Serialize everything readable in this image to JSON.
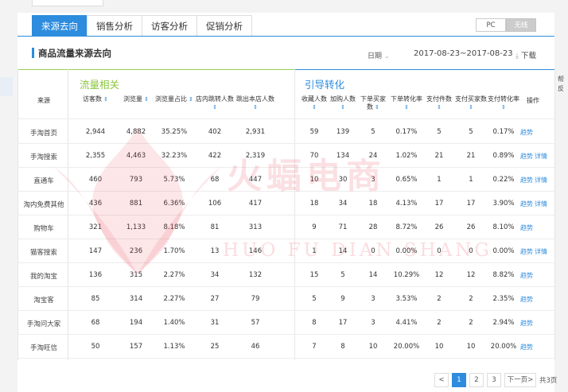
{
  "tabs": [
    {
      "label": "来源去向",
      "active": true
    },
    {
      "label": "销售分析",
      "active": false
    },
    {
      "label": "访客分析",
      "active": false
    },
    {
      "label": "促销分析",
      "active": false
    }
  ],
  "device_toggle": {
    "pc": "PC",
    "wireless": "无线",
    "selected": "无线"
  },
  "section": {
    "title": "商品流量来源去向",
    "date_label": "日期",
    "date_range": "2017-08-23~2017-08-23",
    "download": "下载"
  },
  "groups": {
    "traffic": "流量相关",
    "conversion": "引导转化"
  },
  "columns": [
    "来源",
    "访客数",
    "浏览量",
    "浏览量占比",
    "店内跳转人数",
    "跳出本店人数",
    "收藏人数",
    "加购人数",
    "下单买家数",
    "下单转化率",
    "支付件数",
    "支付买家数",
    "支付转化率",
    "操作"
  ],
  "rows": [
    {
      "src": "手淘首页",
      "v": [
        "2,944",
        "4,882",
        "35.25%",
        "402",
        "2,931",
        "59",
        "139",
        "5",
        "0.17%",
        "5",
        "5",
        "0.17%"
      ],
      "actions": [
        "趋势"
      ]
    },
    {
      "src": "手淘搜索",
      "v": [
        "2,355",
        "4,463",
        "32.23%",
        "422",
        "2,319",
        "70",
        "134",
        "24",
        "1.02%",
        "21",
        "21",
        "0.89%"
      ],
      "actions": [
        "趋势",
        "详情"
      ]
    },
    {
      "src": "直通车",
      "v": [
        "460",
        "793",
        "5.73%",
        "68",
        "447",
        "10",
        "30",
        "3",
        "0.65%",
        "1",
        "1",
        "0.22%"
      ],
      "actions": [
        "趋势",
        "详情"
      ]
    },
    {
      "src": "淘内免费其他",
      "v": [
        "436",
        "881",
        "6.36%",
        "106",
        "417",
        "18",
        "34",
        "18",
        "4.13%",
        "17",
        "17",
        "3.90%"
      ],
      "actions": [
        "趋势",
        "详情"
      ]
    },
    {
      "src": "购物车",
      "v": [
        "321",
        "1,133",
        "8.18%",
        "81",
        "313",
        "9",
        "71",
        "28",
        "8.72%",
        "26",
        "26",
        "8.10%"
      ],
      "actions": [
        "趋势"
      ]
    },
    {
      "src": "猫客搜索",
      "v": [
        "147",
        "236",
        "1.70%",
        "13",
        "146",
        "1",
        "14",
        "0",
        "0.00%",
        "0",
        "0",
        "0.00%"
      ],
      "actions": [
        "趋势",
        "详情"
      ]
    },
    {
      "src": "我的淘宝",
      "v": [
        "136",
        "315",
        "2.27%",
        "34",
        "132",
        "15",
        "5",
        "14",
        "10.29%",
        "12",
        "12",
        "8.82%"
      ],
      "actions": [
        "趋势"
      ]
    },
    {
      "src": "淘宝客",
      "v": [
        "85",
        "314",
        "2.27%",
        "27",
        "79",
        "5",
        "9",
        "3",
        "3.53%",
        "2",
        "2",
        "2.35%"
      ],
      "actions": [
        "趋势"
      ]
    },
    {
      "src": "手淘问大家",
      "v": [
        "68",
        "194",
        "1.40%",
        "31",
        "57",
        "8",
        "17",
        "3",
        "4.41%",
        "2",
        "2",
        "2.94%"
      ],
      "actions": [
        "趋势"
      ]
    },
    {
      "src": "手淘旺信",
      "v": [
        "50",
        "157",
        "1.13%",
        "25",
        "46",
        "7",
        "8",
        "10",
        "20.00%",
        "10",
        "10",
        "20.00%"
      ],
      "actions": [
        "趋势"
      ]
    }
  ],
  "pagination": {
    "prev": "<",
    "pages": [
      "1",
      "2",
      "3"
    ],
    "current": "1",
    "next": "下一页",
    "next_arrow": ">",
    "total": "共3页"
  },
  "watermark": {
    "main": "火蝠电商",
    "sub": "HUO FU DIAN SHANG"
  },
  "side_text": [
    "帮",
    "反"
  ],
  "colors": {
    "accent": "#2d8cde",
    "traffic_group": "#8cc63e",
    "watermark": "#e83c50"
  }
}
